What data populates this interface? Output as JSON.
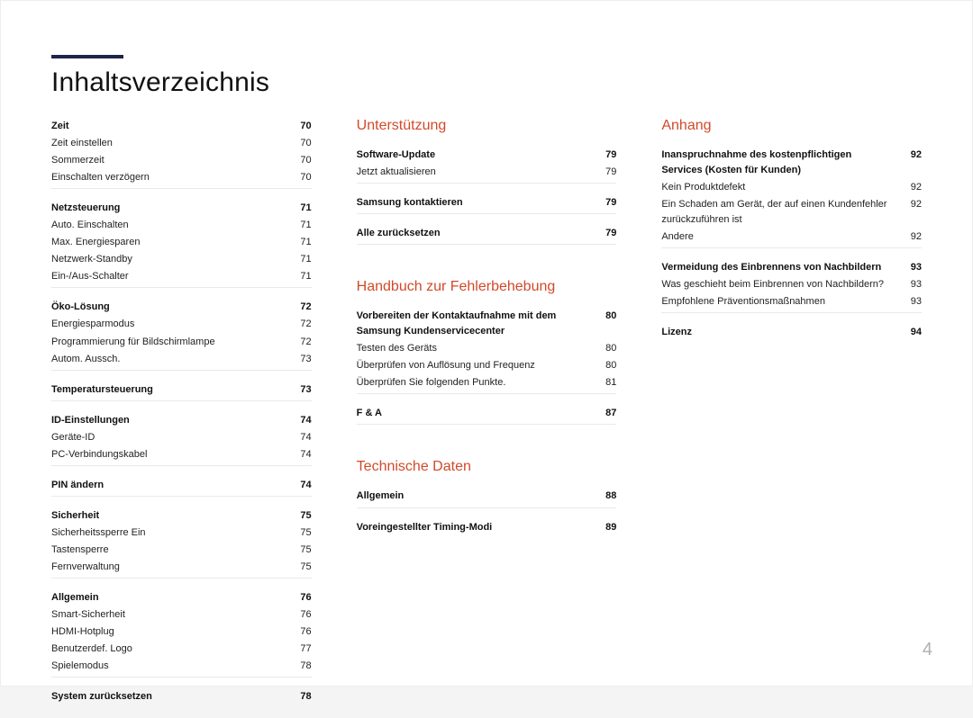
{
  "title": "Inhaltsverzeichnis",
  "page_number": "4",
  "columns": [
    {
      "heading": null,
      "groups": [
        [
          {
            "label": "Zeit",
            "page": "70",
            "bold": true
          },
          {
            "label": "Zeit einstellen",
            "page": "70"
          },
          {
            "label": "Sommerzeit",
            "page": "70"
          },
          {
            "label": "Einschalten verzögern",
            "page": "70"
          }
        ],
        [
          {
            "label": "Netzsteuerung",
            "page": "71",
            "bold": true
          },
          {
            "label": "Auto. Einschalten",
            "page": "71"
          },
          {
            "label": "Max. Energiesparen",
            "page": "71"
          },
          {
            "label": "Netzwerk-Standby",
            "page": "71"
          },
          {
            "label": "Ein-/Aus-Schalter",
            "page": "71"
          }
        ],
        [
          {
            "label": "Öko-Lösung",
            "page": "72",
            "bold": true
          },
          {
            "label": "Energiesparmodus",
            "page": "72"
          },
          {
            "label": "Programmierung für Bildschirmlampe",
            "page": "72"
          },
          {
            "label": "Autom. Aussch.",
            "page": "73"
          }
        ],
        [
          {
            "label": "Temperatursteuerung",
            "page": "73",
            "bold": true
          }
        ],
        [
          {
            "label": "ID-Einstellungen",
            "page": "74",
            "bold": true
          },
          {
            "label": "Geräte-ID",
            "page": "74"
          },
          {
            "label": "PC-Verbindungskabel",
            "page": "74"
          }
        ],
        [
          {
            "label": "PIN ändern",
            "page": "74",
            "bold": true
          }
        ],
        [
          {
            "label": "Sicherheit",
            "page": "75",
            "bold": true
          },
          {
            "label": "Sicherheitssperre Ein",
            "page": "75"
          },
          {
            "label": "Tastensperre",
            "page": "75"
          },
          {
            "label": "Fernverwaltung",
            "page": "75"
          }
        ],
        [
          {
            "label": "Allgemein",
            "page": "76",
            "bold": true
          },
          {
            "label": "Smart-Sicherheit",
            "page": "76"
          },
          {
            "label": "HDMI-Hotplug",
            "page": "76"
          },
          {
            "label": "Benutzerdef. Logo",
            "page": "77"
          },
          {
            "label": "Spielemodus",
            "page": "78"
          }
        ],
        [
          {
            "label": "System zurücksetzen",
            "page": "78",
            "bold": true
          }
        ]
      ]
    },
    {
      "blocks": [
        {
          "heading": "Unterstützung",
          "groups": [
            [
              {
                "label": "Software-Update",
                "page": "79",
                "bold": true
              },
              {
                "label": "Jetzt aktualisieren",
                "page": "79"
              }
            ],
            [
              {
                "label": "Samsung kontaktieren",
                "page": "79",
                "bold": true
              }
            ],
            [
              {
                "label": "Alle zurücksetzen",
                "page": "79",
                "bold": true
              }
            ]
          ]
        },
        {
          "heading": "Handbuch zur Fehlerbehebung",
          "groups": [
            [
              {
                "label": "Vorbereiten der Kontaktaufnahme mit dem Samsung Kundenservicecenter",
                "page": "80",
                "bold": true
              },
              {
                "label": "Testen des Geräts",
                "page": "80"
              },
              {
                "label": "Überprüfen von Auflösung und Frequenz",
                "page": "80"
              },
              {
                "label": "Überprüfen Sie folgenden Punkte.",
                "page": "81"
              }
            ],
            [
              {
                "label": "F & A",
                "page": "87",
                "bold": true
              }
            ]
          ]
        },
        {
          "heading": "Technische Daten",
          "groups": [
            [
              {
                "label": "Allgemein",
                "page": "88",
                "bold": true
              }
            ],
            [
              {
                "label": "Voreingestellter Timing-Modi",
                "page": "89",
                "bold": true
              }
            ]
          ]
        }
      ]
    },
    {
      "blocks": [
        {
          "heading": "Anhang",
          "groups": [
            [
              {
                "label": "Inanspruchnahme des kostenpflichtigen Services (Kosten für Kunden)",
                "page": "92",
                "bold": true
              },
              {
                "label": "Kein Produktdefekt",
                "page": "92"
              },
              {
                "label": "Ein Schaden am Gerät, der auf einen Kundenfehler zurückzuführen ist",
                "page": "92"
              },
              {
                "label": "Andere",
                "page": "92"
              }
            ],
            [
              {
                "label": "Vermeidung des Einbrennens von Nachbildern",
                "page": "93",
                "bold": true
              },
              {
                "label": "Was geschieht beim Einbrennen von Nachbildern?",
                "page": "93"
              },
              {
                "label": "Empfohlene Präventionsmaßnahmen",
                "page": "93"
              }
            ],
            [
              {
                "label": "Lizenz",
                "page": "94",
                "bold": true
              }
            ]
          ]
        }
      ]
    }
  ]
}
